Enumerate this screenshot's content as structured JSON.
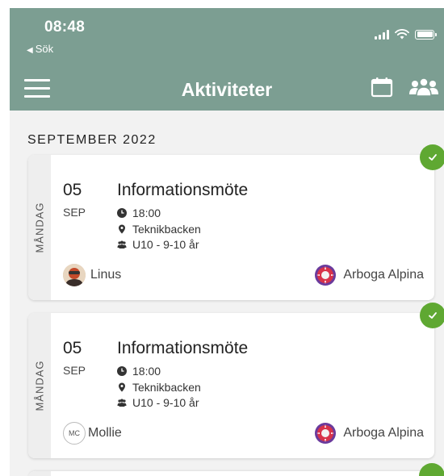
{
  "status_bar": {
    "time": "08:48",
    "back_label": "Sök"
  },
  "header": {
    "title": "Aktiviteter"
  },
  "month_label": "SEPTEMBER 2022",
  "colors": {
    "header": "#7c9e92",
    "check": "#5fa832",
    "background": "#f2f2f2"
  },
  "activities": [
    {
      "weekday": "MÅNDAG",
      "day": "05",
      "month": "SEP",
      "title": "Informationsmöte",
      "time": "18:00",
      "location": "Teknikbacken",
      "group": "U10 - 9-10 år",
      "person": {
        "name": "Linus",
        "avatar": "photo",
        "initials": ""
      },
      "team": "Arboga Alpina",
      "status": "confirmed"
    },
    {
      "weekday": "MÅNDAG",
      "day": "05",
      "month": "SEP",
      "title": "Informationsmöte",
      "time": "18:00",
      "location": "Teknikbacken",
      "group": "U10 - 9-10 år",
      "person": {
        "name": "Mollie",
        "avatar": "initials",
        "initials": "MC"
      },
      "team": "Arboga Alpina",
      "status": "confirmed"
    }
  ],
  "icons": {
    "back": "back-triangle-icon",
    "signal": "signal-icon",
    "wifi": "wifi-icon",
    "battery": "battery-icon",
    "menu": "hamburger-menu-icon",
    "calendar": "calendar-icon",
    "people": "people-icon",
    "clock": "clock-icon",
    "location": "location-pin-icon",
    "group": "group-icon",
    "check": "checkmark-icon",
    "team_logo": "team-logo-icon"
  }
}
